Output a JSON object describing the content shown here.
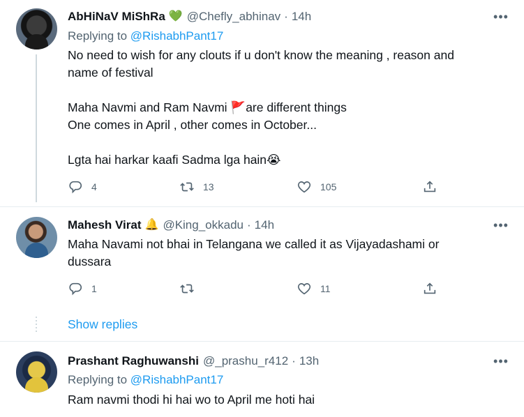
{
  "tweets": [
    {
      "name": "AbHiNaV MiShRa",
      "badge": "💚",
      "handle": "@Chefly_abhinav",
      "time": "14h",
      "replying_prefix": "Replying to",
      "replying_to": "@RishabhPant17",
      "lines": [
        "No need to wish for any clouts if u don't know the meaning , reason and",
        "name of festival",
        "",
        "Maha Navmi and Ram Navmi 🚩are different things",
        "One comes in April , other comes in October...",
        "",
        "Lgta hai harkar kaafi Sadma lga hain😭"
      ],
      "replies": "4",
      "retweets": "13",
      "likes": "105"
    },
    {
      "name": "Mahesh Virat",
      "badge": "🔔",
      "handle": "@King_okkadu",
      "time": "14h",
      "lines": [
        "Maha Navami not bhai in Telangana we called it as Vijayadashami or",
        "dussara"
      ],
      "replies": "1",
      "retweets": "",
      "likes": "11"
    },
    {
      "name": "Prashant Raghuwanshi",
      "handle": "@_prashu_r412",
      "time": "13h",
      "replying_prefix": "Replying to",
      "replying_to": "@RishabhPant17",
      "lines": [
        "Ram navmi thodi hi hai wo to April me hoti hai"
      ]
    }
  ],
  "show_replies": "Show replies",
  "dot": "·",
  "more": "•••",
  "icons": {
    "reply": "reply-icon",
    "retweet": "retweet-icon",
    "like": "heart-icon",
    "share": "share-icon",
    "more": "more-icon"
  },
  "colors": {
    "link": "#1d9bf0",
    "secondary": "#536471",
    "text": "#0f1419"
  }
}
